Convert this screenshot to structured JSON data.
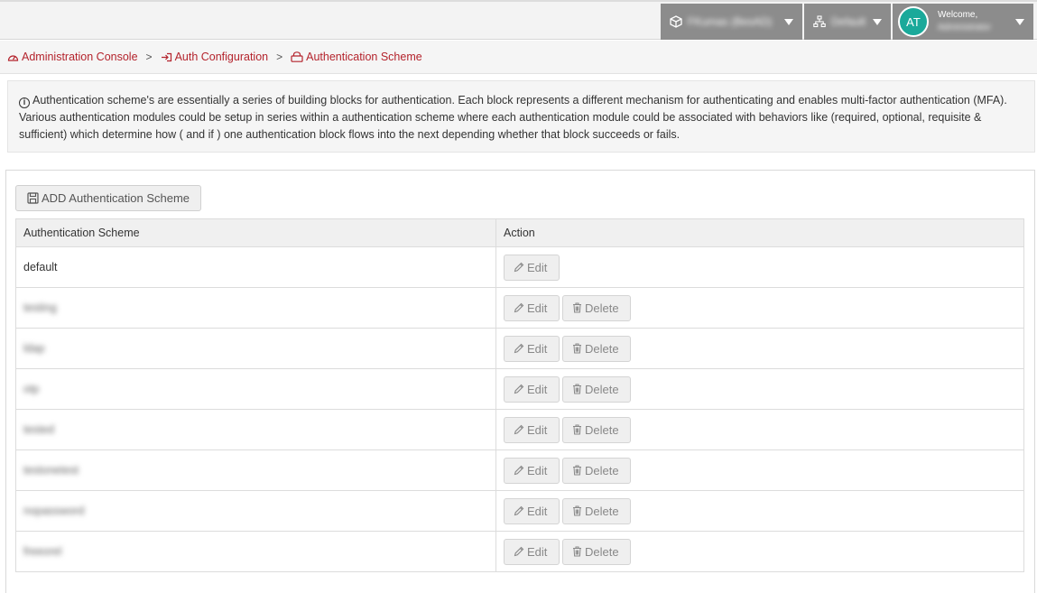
{
  "header": {
    "app_name": "FKumas (BesAD)",
    "environment": "Default",
    "avatar_initials": "AT",
    "welcome": "Welcome,",
    "user_name": "Administrator"
  },
  "breadcrumb": {
    "items": [
      "Administration Console",
      "Auth Configuration",
      "Authentication Scheme"
    ]
  },
  "info": {
    "text": "Authentication scheme's are essentially a series of building blocks for authentication. Each block represents a different mechanism for authenticating and enables multi-factor authentication (MFA). Various authentication modules could be setup in series within a authentication scheme where each authentication module could be associated with behaviors like (required, optional, requisite & sufficient) which determine how ( and if ) one authentication block flows into the next depending whether that block succeeds or fails."
  },
  "toolbar": {
    "add_label": "ADD Authentication Scheme"
  },
  "table": {
    "headers": [
      "Authentication Scheme",
      "Action"
    ],
    "edit_label": "Edit",
    "delete_label": "Delete",
    "rows": [
      {
        "name": "default"
      },
      {
        "name": "testing"
      },
      {
        "name": "ldap"
      },
      {
        "name": "otp"
      },
      {
        "name": "tested"
      },
      {
        "name": "testonetest"
      },
      {
        "name": "nopassword"
      },
      {
        "name": "freeorel"
      }
    ]
  },
  "colors": {
    "accent": "#b4232c",
    "avatar": "#1aa99a",
    "topbar_item": "#8c8c8c"
  }
}
